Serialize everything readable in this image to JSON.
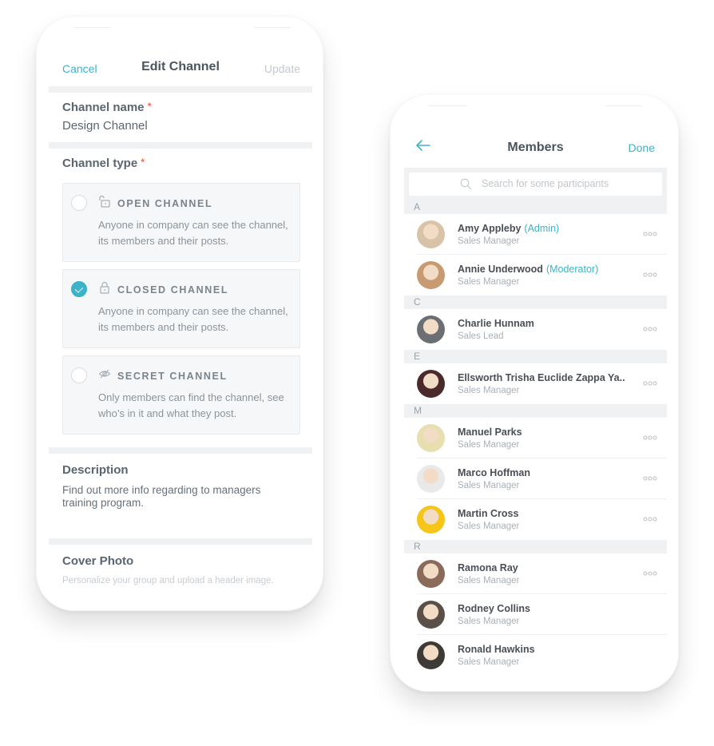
{
  "edit_channel": {
    "nav": {
      "cancel": "Cancel",
      "title": "Edit Channel",
      "update": "Update"
    },
    "channel_name": {
      "label": "Channel name",
      "required_mark": "*",
      "value": "Design Channel"
    },
    "channel_type": {
      "label": "Channel type",
      "required_mark": "*",
      "options": [
        {
          "icon": "unlocked-icon",
          "name": "OPEN CHANNEL",
          "description": "Anyone in company can see the channel, its members and their posts.",
          "selected": false
        },
        {
          "icon": "lock-icon",
          "name": "CLOSED CHANNEL",
          "description": "Anyone in company can see the channel, its members and their posts.",
          "selected": true
        },
        {
          "icon": "eye-off-icon",
          "name": "SECRET CHANNEL",
          "description": "Only members can find the channel, see who’s in it and what they post.",
          "selected": false
        }
      ]
    },
    "description": {
      "label": "Description",
      "value": "Find out more info regarding to managers training program."
    },
    "cover_photo": {
      "label": "Cover Photo",
      "hint": "Personalize your group and upload a header image."
    }
  },
  "members": {
    "nav": {
      "back_icon": "arrow-left-icon",
      "title": "Members",
      "done": "Done"
    },
    "search": {
      "placeholder": "Search for some participants"
    },
    "sections": [
      {
        "letter": "A",
        "members": [
          {
            "name": "Amy Appleby",
            "role": "(Admin)",
            "title": "Sales Manager",
            "has_more": true,
            "avatar_color": "#d9c3a8"
          },
          {
            "name": "Annie Underwood",
            "role": "(Moderator)",
            "title": "Sales Manager",
            "has_more": true,
            "avatar_color": "#c79a72"
          }
        ]
      },
      {
        "letter": "C",
        "members": [
          {
            "name": "Charlie Hunnam",
            "role": "",
            "title": "Sales Lead",
            "has_more": true,
            "avatar_color": "#6b6f74"
          }
        ]
      },
      {
        "letter": "E",
        "members": [
          {
            "name": "Ellsworth Trisha Euclide Zappa Ya..",
            "role": "",
            "title": "Sales Manager",
            "has_more": true,
            "avatar_color": "#4a2a2a"
          }
        ]
      },
      {
        "letter": "M",
        "members": [
          {
            "name": "Manuel Parks",
            "role": "",
            "title": "Sales Manager",
            "has_more": true,
            "avatar_color": "#e8dfb0"
          },
          {
            "name": "Marco Hoffman",
            "role": "",
            "title": "Sales Manager",
            "has_more": true,
            "avatar_color": "#e9e9e9"
          },
          {
            "name": "Martin Cross",
            "role": "",
            "title": "Sales Manager",
            "has_more": true,
            "avatar_color": "#f5c518"
          }
        ]
      },
      {
        "letter": "R",
        "members": [
          {
            "name": "Ramona Ray",
            "role": "",
            "title": "Sales Manager",
            "has_more": true,
            "avatar_color": "#8a6a58"
          },
          {
            "name": "Rodney Collins",
            "role": "",
            "title": "Sales Manager",
            "has_more": false,
            "avatar_color": "#5a5048"
          },
          {
            "name": "Ronald Hawkins",
            "role": "",
            "title": "Sales Manager",
            "has_more": false,
            "avatar_color": "#3e3a36"
          }
        ]
      }
    ]
  },
  "colors": {
    "accent": "#3bb3c8",
    "required": "#f06a50",
    "section_bg": "#f0f1f2"
  }
}
